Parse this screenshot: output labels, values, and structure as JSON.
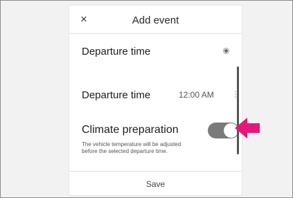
{
  "dialog": {
    "title": "Add event",
    "close_icon": "close-icon",
    "close_glyph": "×"
  },
  "rows": {
    "departure_option_label": "Departure time",
    "departure_option_selected": true,
    "departure_time_label": "Departure time",
    "departure_time_value": "12:00 AM",
    "more_glyph": "⋮",
    "climate_label": "Climate preparation",
    "climate_enabled": true,
    "climate_description": "The vehicle temperature will be adjusted before the selected departure time."
  },
  "footer": {
    "save_label": "Save"
  },
  "colors": {
    "toggle_on": "#7a7a7a",
    "pointer_arrow": "#e6177a",
    "scrollbar": "#555555"
  },
  "icons": {
    "radio": "radio-selected-icon",
    "more": "more-vertical-icon",
    "pointer": "pointer-arrow-icon"
  }
}
